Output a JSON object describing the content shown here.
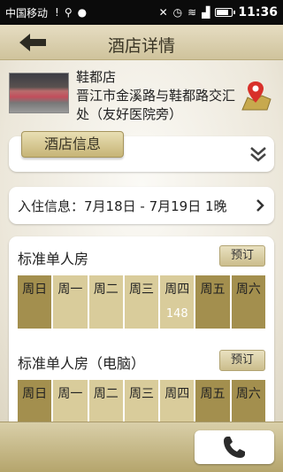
{
  "status_bar": {
    "carrier": "中国移动",
    "time": "11:36"
  },
  "header": {
    "title": "酒店详情"
  },
  "hotel": {
    "name": "鞋都店",
    "address": "晋江市金溪路与鞋都路交汇处（友好医院旁）"
  },
  "info_section": {
    "tab_label": "酒店信息"
  },
  "checkin": {
    "text": "入住信息：7月18日 - 7月19日  1晚"
  },
  "rooms": [
    {
      "name": "标准单人房",
      "book_label": "预订",
      "days": [
        {
          "label": "周日",
          "price": ""
        },
        {
          "label": "周一",
          "price": ""
        },
        {
          "label": "周二",
          "price": ""
        },
        {
          "label": "周三",
          "price": ""
        },
        {
          "label": "周四",
          "price": "148"
        },
        {
          "label": "周五",
          "price": ""
        },
        {
          "label": "周六",
          "price": ""
        }
      ]
    },
    {
      "name": "标准单人房（电脑）",
      "book_label": "预订",
      "days": [
        {
          "label": "周日",
          "price": ""
        },
        {
          "label": "周一",
          "price": ""
        },
        {
          "label": "周二",
          "price": ""
        },
        {
          "label": "周三",
          "price": ""
        },
        {
          "label": "周四",
          "price": ""
        },
        {
          "label": "周五",
          "price": ""
        },
        {
          "label": "周六",
          "price": ""
        }
      ]
    }
  ],
  "colors": {
    "weekday_cell": "#d9cc9b",
    "weekend_cell": "#a38f4e",
    "accent_gold": "#c6b476"
  },
  "icons": {
    "back": "arrow-left-icon",
    "map": "map-pin-icon",
    "expand": "double-chevron-down-icon",
    "next": "chevron-right-icon",
    "call": "phone-icon"
  }
}
